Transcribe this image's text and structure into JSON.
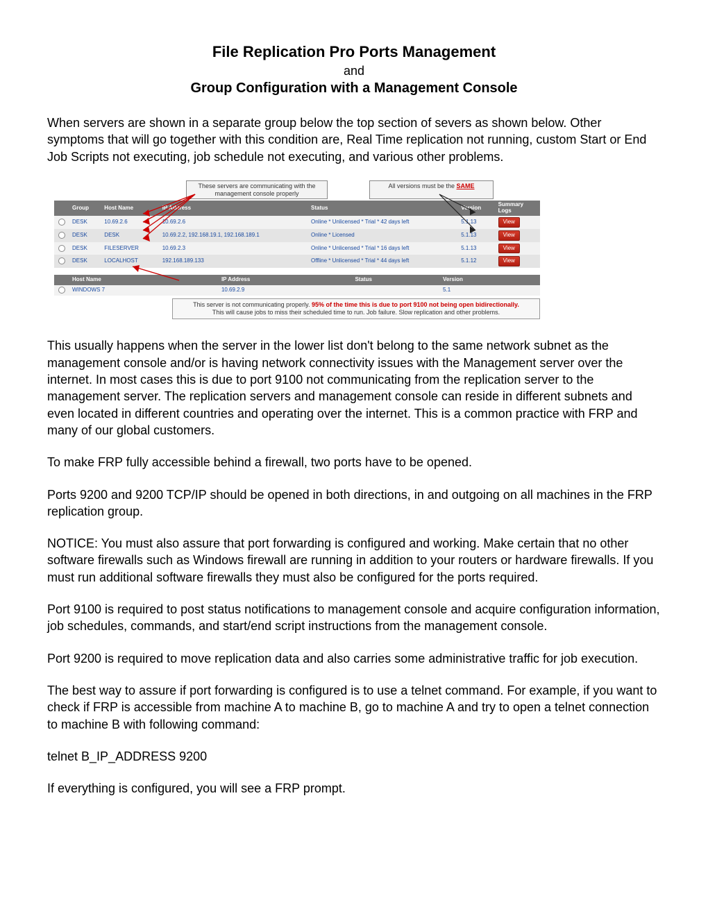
{
  "title": {
    "line1": "File Replication Pro Ports Management",
    "and": "and",
    "line2": "Group Configuration with a Management Console"
  },
  "paragraphs": {
    "intro": "When servers are shown in a separate group below the top section of severs as shown below. Other symptoms that will go together with this condition are, Real Time replication not running, custom Start or End Job Scripts not executing, job schedule not executing, and various other problems.",
    "p1": "This usually happens when the server in the lower list don't belong to the same network subnet as the management console and/or is having network connectivity issues with the Management server over the internet. In most cases this is due to port 9100 not communicating from the replication server to the management server. The replication servers and management console can reside in different subnets and even located in different countries and operating over the internet.  This is a common practice with FRP and many of our global customers.",
    "p2": "To make FRP fully accessible behind a firewall, two ports have to be opened.",
    "p3": "Ports 9200 and 9200 TCP/IP should be opened in both directions, in and outgoing on all machines in the FRP replication group.",
    "p4": "NOTICE: You must also assure that port forwarding is configured and working. Make certain that no other software firewalls such as Windows firewall are running in addition to your routers or hardware firewalls.  If you must run additional software firewalls they must also be configured for the ports required.",
    "p5": "Port 9100 is required to post status notifications to management console and acquire configuration information, job schedules, commands, and start/end script instructions from the management console.",
    "p6": "Port 9200 is required to move replication data and also carries some administrative traffic for job execution.",
    "p7": "The best way to assure if port forwarding is configured is to use a telnet command. For example, if you want to check if FRP is accessible from machine A to machine B, go to machine A and try to open a telnet connection to machine B with following command:",
    "p8": "telnet B_IP_ADDRESS 9200",
    "p9": "If everything is configured, you will see a FRP prompt."
  },
  "diagram": {
    "callout_left": "These servers are communicating with the management console properly",
    "callout_right_prefix": "All versions must be the ",
    "callout_right_same": "SAME",
    "headers1": {
      "group": "Group",
      "host": "Host Name",
      "ip": "IP Address",
      "status": "Status",
      "version": "Version",
      "summary": "Summary\nLogs"
    },
    "rows1": [
      {
        "group": "DESK",
        "host": "10.69.2.6",
        "ip": "10.69.2.6",
        "status": "Online * Unlicensed * Trial * 42 days left",
        "version": "5.1.13",
        "view": "View"
      },
      {
        "group": "DESK",
        "host": "DESK",
        "ip": "10.69.2.2, 192.168.19.1, 192.168.189.1",
        "status": "Online * Licensed",
        "version": "5.1.13",
        "view": "View"
      },
      {
        "group": "DESK",
        "host": "FILESERVER",
        "ip": "10.69.2.3",
        "status": "Online * Unlicensed * Trial * 16 days left",
        "version": "5.1.13",
        "view": "View"
      },
      {
        "group": "DESK",
        "host": "LOCALHOST",
        "ip": "192.168.189.133",
        "status": "Offline * Unlicensed * Trial * 44 days left",
        "offline": true,
        "version": "5.1.12",
        "view": "View"
      }
    ],
    "headers2": {
      "host": "Host Name",
      "ip": "IP Address",
      "status": "Status",
      "version": "Version"
    },
    "rows2": [
      {
        "host": "WINDOWS 7",
        "ip": "10.69.2.9",
        "status": "",
        "version": "5.1"
      }
    ],
    "footnote_prefix": "This server is not communicating properly.  ",
    "footnote_hot": "95% of the time this is due to port 9100 not being open bidirectionally.",
    "footnote_suffix": "This will cause jobs to miss their scheduled time to run.  Job failure.  Slow replication and other problems."
  }
}
